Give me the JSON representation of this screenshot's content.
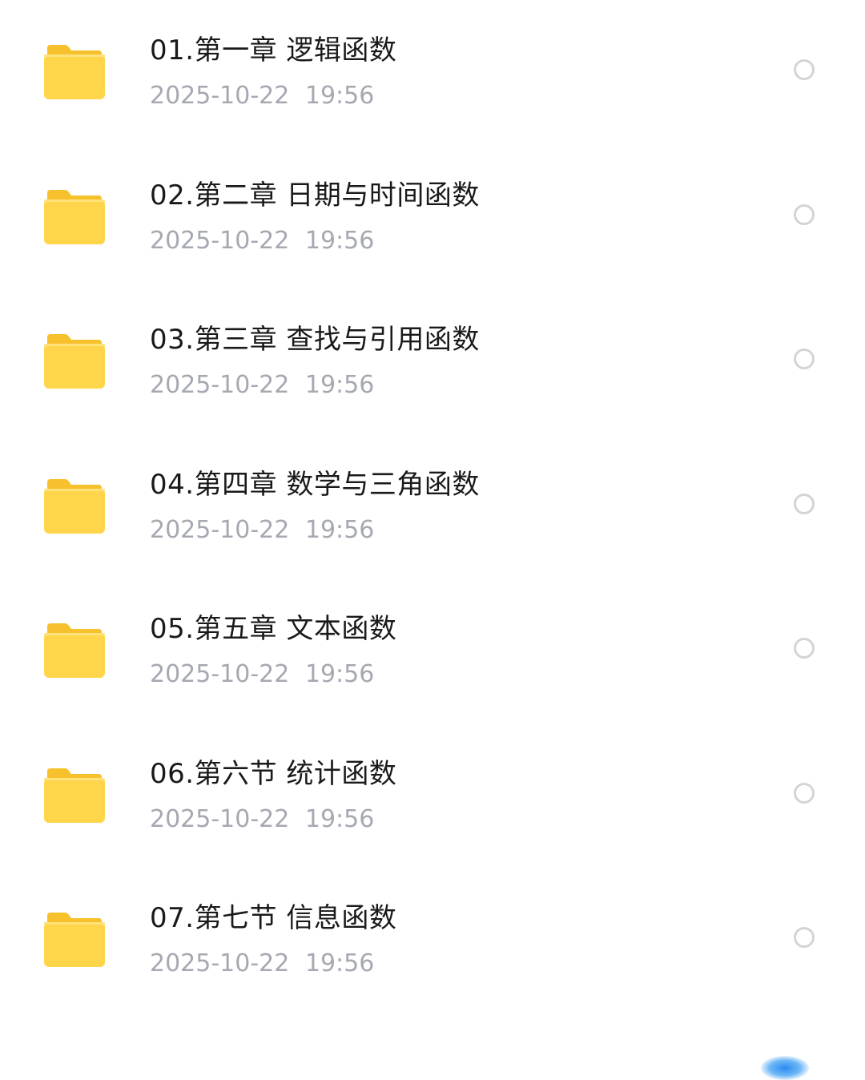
{
  "icons": {
    "folder": "folder-icon",
    "select": "radio-unchecked-icon"
  },
  "colors": {
    "folder": "#FFD54A",
    "name_text": "#1A1A1A",
    "date_text": "#A6A8B2",
    "radio_border": "#D3D4D8"
  },
  "files": [
    {
      "name": "01.第一章 逻辑函数",
      "date": "2025-10-22 19:56"
    },
    {
      "name": "02.第二章 日期与时间函数",
      "date": "2025-10-22 19:56"
    },
    {
      "name": "03.第三章 查找与引用函数",
      "date": "2025-10-22 19:56"
    },
    {
      "name": "04.第四章 数学与三角函数",
      "date": "2025-10-22 19:56"
    },
    {
      "name": "05.第五章 文本函数",
      "date": "2025-10-22 19:56"
    },
    {
      "name": "06.第六节 统计函数",
      "date": "2025-10-22 19:56"
    },
    {
      "name": "07.第七节 信息函数",
      "date": "2025-10-22 19:56"
    }
  ]
}
